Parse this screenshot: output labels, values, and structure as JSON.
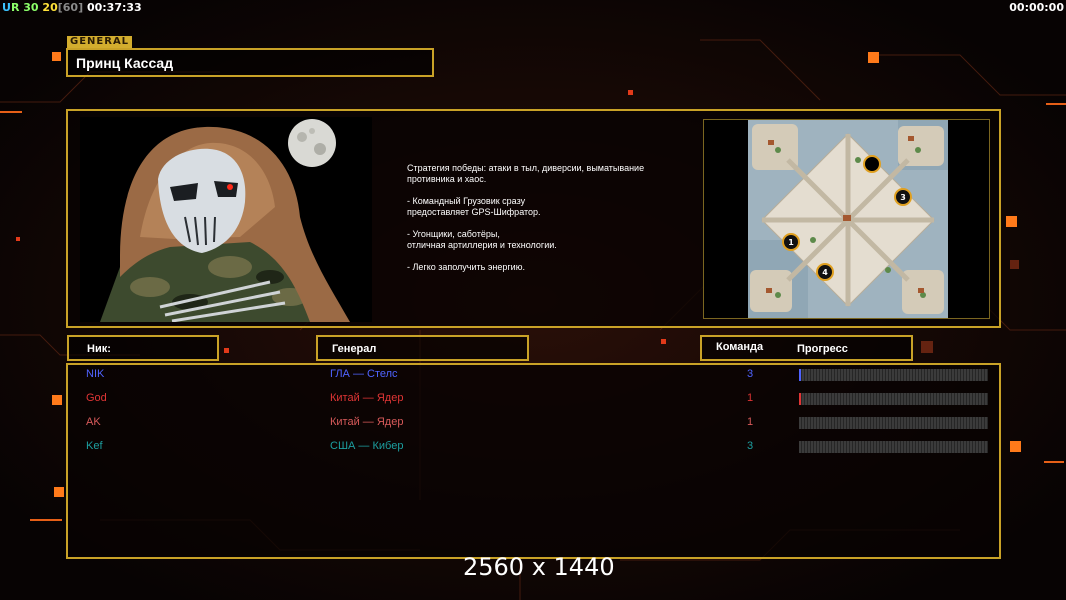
{
  "hud": {
    "u": "U",
    "r": "R",
    "money": "30",
    "power": "20",
    "power_max": "[60]",
    "timer": "00:37:33",
    "timer_right": "00:00:00"
  },
  "general_tag": "GENERAL",
  "general_name": "Принц Кассад",
  "description": [
    "Стратегия победы: атаки в тыл, диверсии, выматывание\n противника и хаос.",
    "- Командный Грузовик сразу\nпредоставляет GPS-Шифратор.",
    "- Угонщики, саботёры,\nотличная артиллерия и технологии.",
    "- Легко заполучить энергию."
  ],
  "map_spots": [
    "1",
    "3",
    "4"
  ],
  "columns": {
    "nick": "Ник:",
    "general": "Генерал",
    "team": "Команда",
    "progress": "Прогресс"
  },
  "players": [
    {
      "nick": "NIK",
      "general": "ГЛА — Стелс",
      "team": "3",
      "color": "#4f63ff",
      "progress": 0.01
    },
    {
      "nick": "God",
      "general": "Китай — Ядер",
      "team": "1",
      "color": "#e03535",
      "progress": 0.01
    },
    {
      "nick": "AK",
      "general": "Китай — Ядер",
      "team": "1",
      "color": "#d85a5a",
      "progress": 0.0
    },
    {
      "nick": "Kef",
      "general": "США — Кибер",
      "team": "3",
      "color": "#1c9fa0",
      "progress": 0.0
    }
  ],
  "resolution_label": "2560 x 1440",
  "colors": {
    "accent": "#c9a227",
    "orange": "#ff8a1e"
  }
}
